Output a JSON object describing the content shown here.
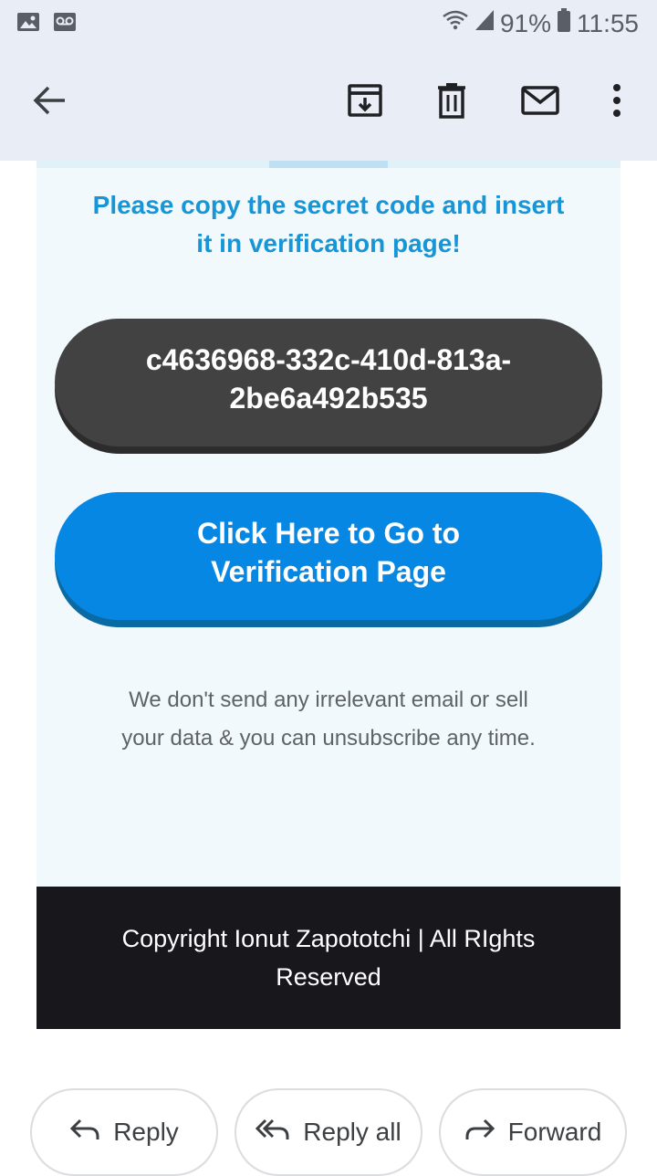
{
  "status_bar": {
    "battery": "91%",
    "time": "11:55"
  },
  "app_bar": {
    "icons": [
      "back-arrow-icon",
      "archive-icon",
      "delete-icon",
      "mark-unread-icon",
      "more-vert-icon"
    ]
  },
  "email": {
    "headline": "Please copy the secret code and insert it in verification page!",
    "secret_code": "c4636968-332c-410d-813a-2be6a492b535",
    "verify_button": "Click Here to Go to Verification Page",
    "note": "We don't send any irrelevant email or sell your data & you can unsubscribe any time.",
    "footer": "Copyright Ionut Zapototchi | All RIghts Reserved"
  },
  "actions": {
    "reply": "Reply",
    "reply_all": "Reply all",
    "forward": "Forward"
  },
  "colors": {
    "accent_blue": "#1795d6",
    "button_blue": "#0687e4",
    "code_dark": "#424242",
    "footer_bg": "#18171c"
  }
}
